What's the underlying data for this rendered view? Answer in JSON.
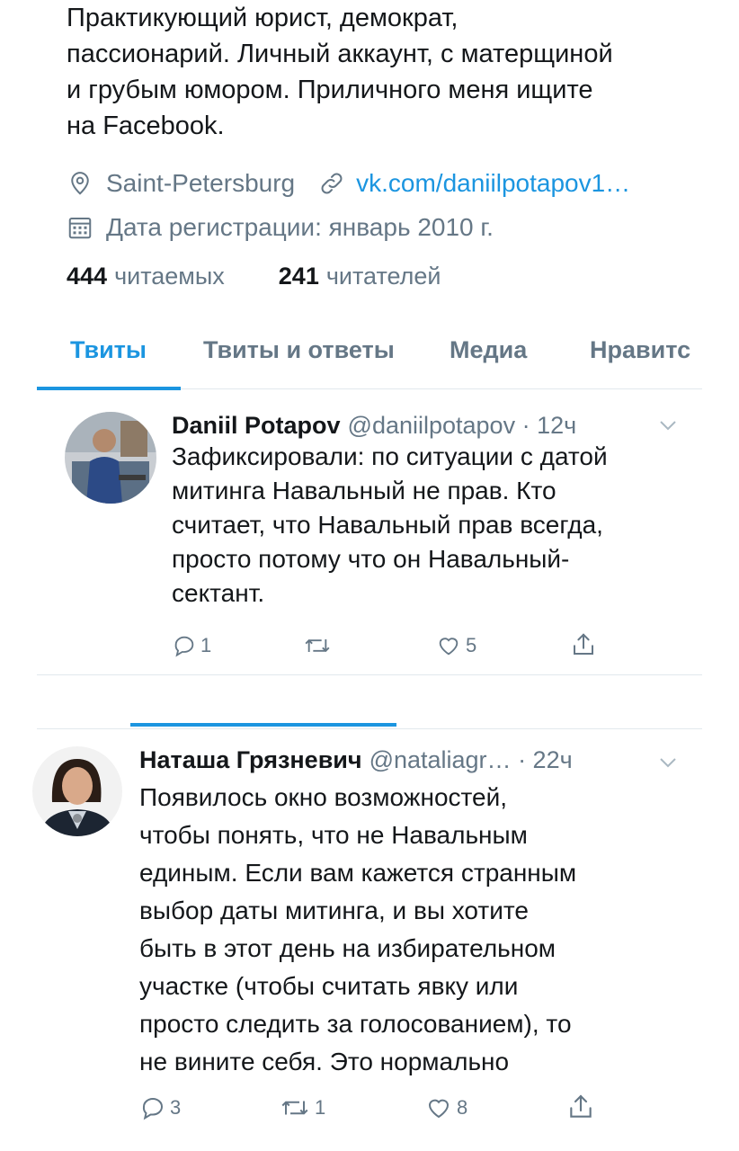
{
  "profile": {
    "bio": [
      "Практикующий юрист, демократ,",
      "пассионарий. Личный аккаунт, с матерщиной",
      "и грубым юмором. Приличного меня ищите",
      "на Facebook."
    ],
    "location": "Saint-Petersburg",
    "link": "vk.com/daniilpotapov1…",
    "joined": "Дата регистрации: январь 2010 г.",
    "following_count": "444",
    "following_label": "читаемых",
    "followers_count": "241",
    "followers_label": "читателей"
  },
  "tabs": [
    {
      "label": "Твиты",
      "active": true
    },
    {
      "label": "Твиты и ответы",
      "active": false
    },
    {
      "label": "Медиа",
      "active": false
    },
    {
      "label": "Нравитс",
      "active": false
    }
  ],
  "tweets": [
    {
      "name": "Daniil Potapov",
      "handle": "@daniilpotapov",
      "time": "· 12ч",
      "lines": [
        "Зафиксировали: по ситуации с датой",
        "митинга Навальный не прав. Кто",
        "считает, что Навальный прав всегда,",
        "просто потому что он Навальный-",
        "сектант."
      ],
      "replies": "1",
      "retweets": "",
      "likes": "5"
    },
    {
      "name": "Наташа Грязневич",
      "handle": "@nataliagr…",
      "time": "· 22ч",
      "lines": [
        "Появилось окно возможностей,",
        "чтобы понять, что не Навальным",
        "единым. Если вам кажется странным",
        "выбор даты митинга, и вы хотите",
        "быть в этот день на избирательном",
        "участке (чтобы считать явку или",
        "просто следить за голосованием), то",
        "не вините себя. Это нормально"
      ],
      "replies": "3",
      "retweets": "1",
      "likes": "8"
    }
  ],
  "colors": {
    "accent": "#1b95e0",
    "secondary": "#657786",
    "text": "#14171a",
    "divider": "#e1e8ed"
  },
  "icons": [
    "location-icon",
    "link-icon",
    "calendar-icon",
    "chevron-down-icon",
    "reply-icon",
    "retweet-icon",
    "like-icon",
    "share-icon"
  ]
}
